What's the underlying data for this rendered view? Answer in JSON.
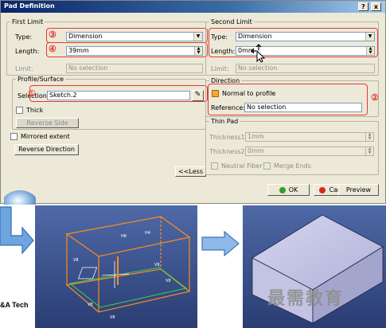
{
  "dialog": {
    "title": "Pad Definition",
    "help_btn": "?",
    "close_btn": "x"
  },
  "first_limit": {
    "legend": "First Limit",
    "type_label": "Type:",
    "type_value": "Dimension",
    "length_label": "Length:",
    "length_value": "39mm",
    "limit_label": "Limit:",
    "limit_value": "No selection",
    "badge_type": "③",
    "badge_length": "④"
  },
  "profile": {
    "legend": "Profile/Surface",
    "selection_label": "Selection:",
    "selection_value": "Sketch.2",
    "badge": "①",
    "thick_label": "Thick",
    "reverse_side": "Reverse Side"
  },
  "mirrored_label": "Mirrored extent",
  "reverse_direction": "Reverse Direction",
  "less_button": "<<Less",
  "second_limit": {
    "legend": "Second Limit",
    "type_label": "Type:",
    "type_value": "Dimension",
    "length_label": "Length:",
    "length_value": "0mm",
    "limit_label": "Limit:",
    "limit_value": "No selection"
  },
  "direction": {
    "legend": "Direction",
    "normal_label": "Normal to profile",
    "reference_label": "Reference:",
    "reference_value": "No selection",
    "badge": "②"
  },
  "thin_pad": {
    "legend": "Thin Pad",
    "thickness1_label": "Thickness1:",
    "thickness1_value": "1mm",
    "thickness2_label": "Thickness2:",
    "thickness2_value": "0mm",
    "neutral_label": "Neutral Fiber",
    "merge_label": "Merge Ends"
  },
  "buttons": {
    "ok": "OK",
    "cancel": "Cancel",
    "preview": "Preview"
  },
  "illustration": {
    "footer_text": "&A Tech",
    "watermark": "最需教育",
    "dim_labels": [
      "H8",
      "H4",
      "V8",
      "V8",
      "V8",
      "V8",
      "V8"
    ]
  },
  "colors": {
    "titlebar": "#0a246a",
    "dialog_bg": "#ece9d8",
    "annotation_red": "#e53935",
    "sketch_orange": "#ff8c1a",
    "viewport_blue": "#3d5f9c",
    "box_face": "#bbbcdc",
    "arrow_blue": "#5f98d8",
    "ok_green": "#2e9e2e",
    "cancel_red": "#d52b1e"
  }
}
